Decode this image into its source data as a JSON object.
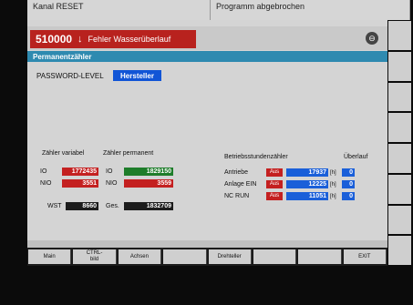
{
  "topbar": {
    "left": "Kanal RESET",
    "right": "Programm abgebrochen"
  },
  "alarm": {
    "number": "510000",
    "text": "Fehler Wasserüberlauf"
  },
  "title": "Permanentzähler",
  "password": {
    "label": "PASSWORD-LEVEL",
    "value": "Hersteller"
  },
  "counters": {
    "variable_header": "Zähler variabel",
    "permanent_header": "Zähler permanent",
    "io_label": "IO",
    "nio_label": "NIO",
    "wst_label": "WST",
    "ges_label": "Ges.",
    "io_var": "1772435",
    "nio_var": "3551",
    "wst_var": "8660",
    "io_perm": "1829150",
    "nio_perm": "3559",
    "ges_perm": "1832709"
  },
  "hours": {
    "header": "Betriebsstundenzähler",
    "overflow_header": "Überlauf",
    "rows": [
      {
        "label": "Antriebe",
        "aus": "Aus",
        "value": "17937",
        "unit": "[h]",
        "overflow": "0"
      },
      {
        "label": "Anlage EIN",
        "aus": "Aus",
        "value": "12225",
        "unit": "[h]",
        "overflow": "0"
      },
      {
        "label": "NC RUN",
        "aus": "Aus",
        "value": "11051",
        "unit": "[h]",
        "overflow": "0"
      }
    ]
  },
  "softkeys": [
    "Main",
    "CTRL-\nbild",
    "Achsen",
    "",
    "Drehteller",
    "",
    "",
    "EXIT"
  ]
}
